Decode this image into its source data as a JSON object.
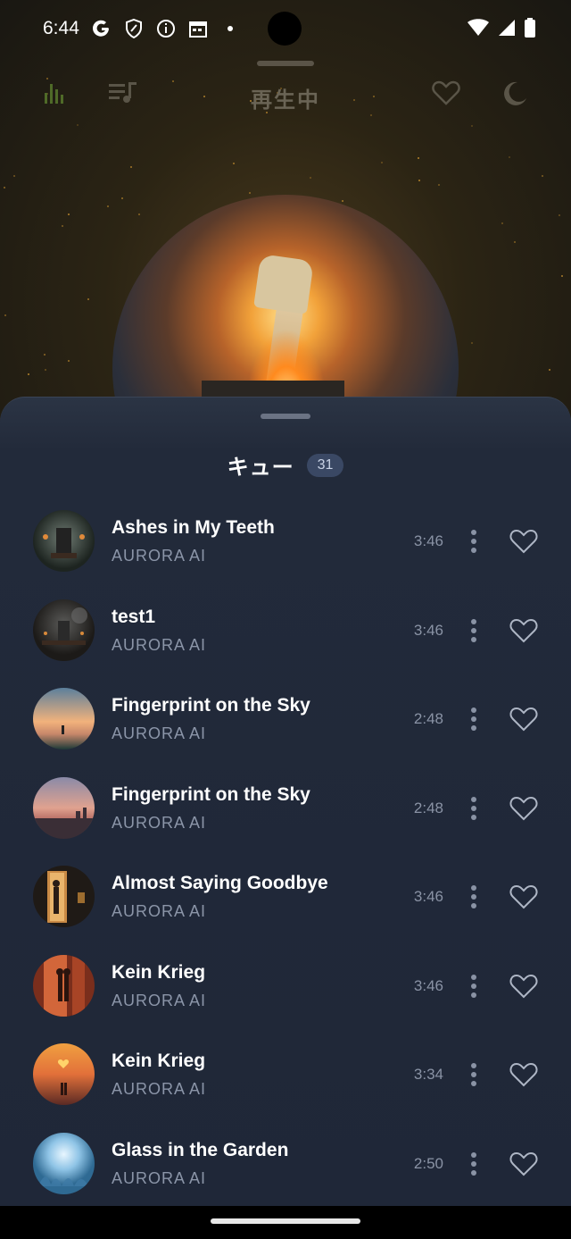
{
  "status_bar": {
    "time": "6:44",
    "icons": [
      "google-icon",
      "shield-icon",
      "info-icon",
      "calendar-icon",
      "dot-icon"
    ],
    "right_icons": [
      "wifi-icon",
      "cellular-icon",
      "battery-icon"
    ]
  },
  "player": {
    "title": "再生中",
    "toolbar_icons": [
      "equalizer-icon",
      "queue-music-icon",
      "heart-icon",
      "moon-icon"
    ]
  },
  "queue": {
    "title": "キュー",
    "count": "31",
    "tracks": [
      {
        "title": "Ashes in My Teeth",
        "artist": "AURORA AI",
        "duration": "3:46"
      },
      {
        "title": "test1",
        "artist": "AURORA AI",
        "duration": "3:46"
      },
      {
        "title": "Fingerprint on the Sky",
        "artist": "AURORA AI",
        "duration": "2:48"
      },
      {
        "title": "Fingerprint on the Sky",
        "artist": "AURORA AI",
        "duration": "2:48"
      },
      {
        "title": "Almost Saying Goodbye",
        "artist": "AURORA AI",
        "duration": "3:46"
      },
      {
        "title": "Kein Krieg",
        "artist": "AURORA AI",
        "duration": "3:46"
      },
      {
        "title": "Kein Krieg",
        "artist": "AURORA AI",
        "duration": "3:34"
      },
      {
        "title": "Glass in the Garden",
        "artist": "AURORA AI",
        "duration": "2:50"
      }
    ]
  },
  "colors": {
    "sheet_bg": "#1f2738",
    "accent_green": "#5d7a2e",
    "badge_bg": "#3a4864",
    "muted_text": "#8b95a8"
  }
}
